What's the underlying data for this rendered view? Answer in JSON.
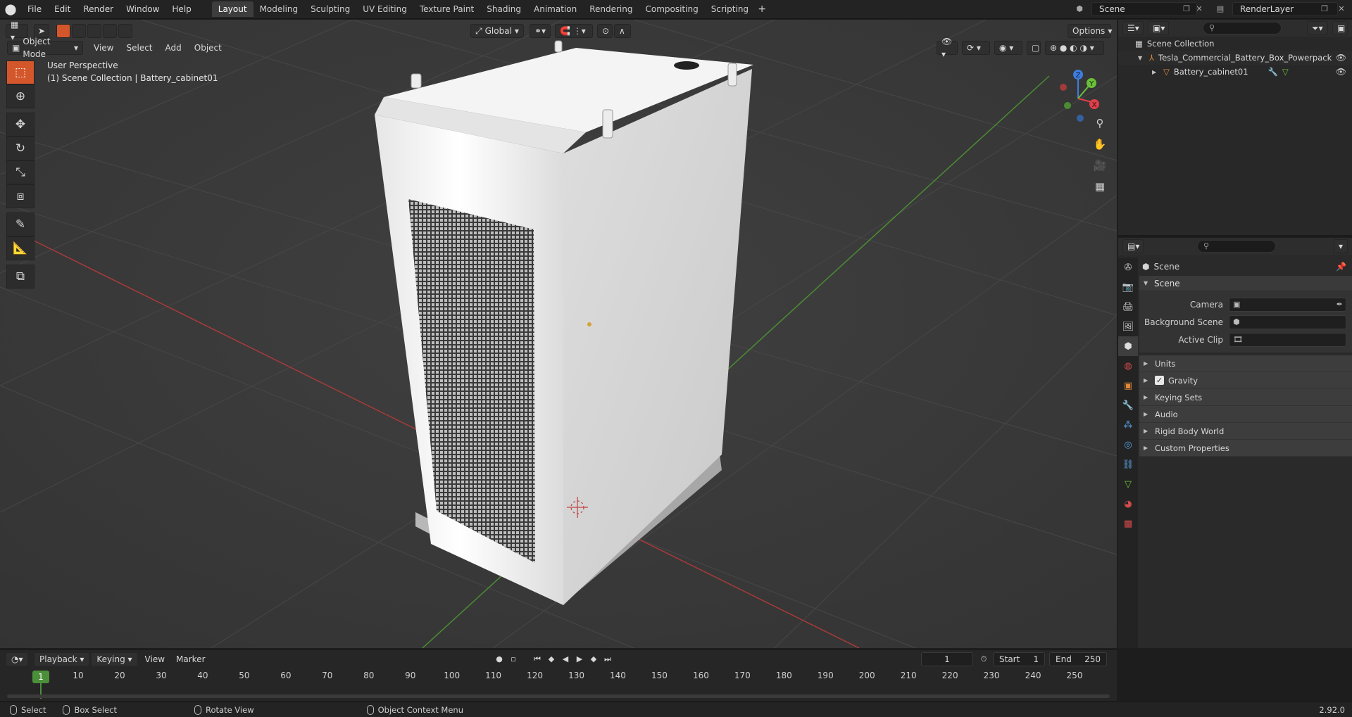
{
  "topbar": {
    "menus": [
      "File",
      "Edit",
      "Render",
      "Window",
      "Help"
    ],
    "workspaces": [
      "Layout",
      "Modeling",
      "Sculpting",
      "UV Editing",
      "Texture Paint",
      "Shading",
      "Animation",
      "Rendering",
      "Compositing",
      "Scripting"
    ],
    "active_workspace": "Layout",
    "add_label": "+",
    "scene_name": "Scene",
    "view_layer_name": "RenderLayer"
  },
  "viewport": {
    "mode_label": "Object Mode",
    "menus": [
      "View",
      "Select",
      "Add",
      "Object"
    ],
    "transform_orientation": "Global",
    "options_label": "Options",
    "perspective_label": "User Perspective",
    "collection_label": "(1) Scene Collection | Battery_cabinet01",
    "gizmo_axes": {
      "x": "X",
      "y": "Y",
      "z": "Z"
    }
  },
  "outliner": {
    "root": "Scene Collection",
    "collection": "Tesla_Commercial_Battery_Box_Powerpack",
    "object": "Battery_cabinet01"
  },
  "properties": {
    "context_title": "Scene",
    "panel_title": "Scene",
    "fields": [
      {
        "label": "Camera",
        "value": ""
      },
      {
        "label": "Background Scene",
        "value": ""
      },
      {
        "label": "Active Clip",
        "value": ""
      }
    ],
    "subpanels": [
      "Units",
      "Gravity",
      "Keying Sets",
      "Audio",
      "Rigid Body World",
      "Custom Properties"
    ]
  },
  "timeline": {
    "menus": [
      "Playback",
      "Keying",
      "View",
      "Marker"
    ],
    "current_frame": "1",
    "start_label": "Start",
    "start_value": "1",
    "end_label": "End",
    "end_value": "250",
    "ticks": [
      "1",
      "10",
      "20",
      "30",
      "40",
      "50",
      "60",
      "70",
      "80",
      "90",
      "100",
      "110",
      "120",
      "130",
      "140",
      "150",
      "160",
      "170",
      "180",
      "190",
      "200",
      "210",
      "220",
      "230",
      "240",
      "250"
    ]
  },
  "statusbar": {
    "select": "Select",
    "box_select": "Box Select",
    "rotate_view": "Rotate View",
    "context_menu": "Object Context Menu",
    "version": "2.92.0"
  },
  "colors": {
    "accent_orange": "#d4572c",
    "frame_green": "#4c8f3a",
    "axis_x": "#e0404a",
    "axis_y": "#6bbf3a",
    "axis_z": "#3d7ee0"
  }
}
